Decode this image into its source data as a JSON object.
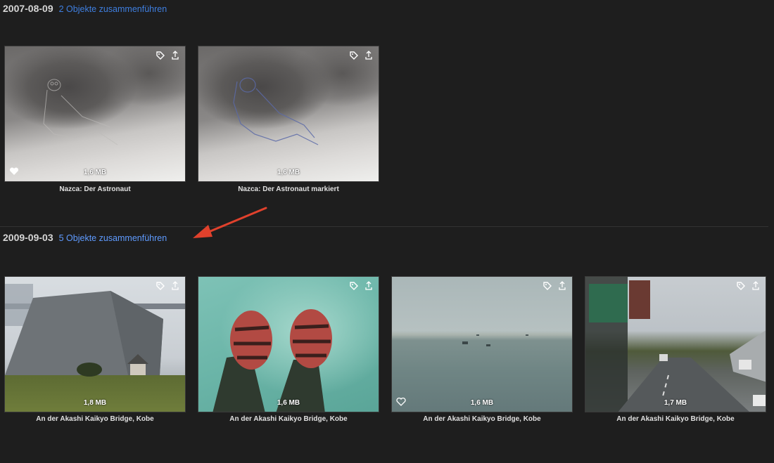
{
  "groups": [
    {
      "date": "2007-08-09",
      "merge_label": "2 Objekte zusammenführen",
      "items": [
        {
          "size": "1,6 MB",
          "caption": "Nazca: Der Astronaut",
          "favorite": true
        },
        {
          "size": "1,6 MB",
          "caption": "Nazca: Der Astronaut markiert",
          "favorite": false
        }
      ]
    },
    {
      "date": "2009-09-03",
      "merge_label": "5 Objekte zusammenführen",
      "items": [
        {
          "size": "1,8 MB",
          "caption": "An der Akashi Kaikyo Bridge, Kobe",
          "favorite": false
        },
        {
          "size": "1,6 MB",
          "caption": "An der Akashi Kaikyo Bridge, Kobe",
          "favorite": false
        },
        {
          "size": "1,6 MB",
          "caption": "An der Akashi Kaikyo Bridge, Kobe",
          "favorite": true
        },
        {
          "size": "1,7 MB",
          "caption": "An der Akashi Kaikyo Bridge, Kobe",
          "favorite": false
        }
      ]
    }
  ],
  "icons": {
    "tag": "tag-icon",
    "share": "share-icon",
    "favorite": "heart-icon",
    "annotation": "arrow-annotation"
  },
  "colors": {
    "link": "#5f9bff",
    "annotation_arrow": "#e0412c"
  }
}
